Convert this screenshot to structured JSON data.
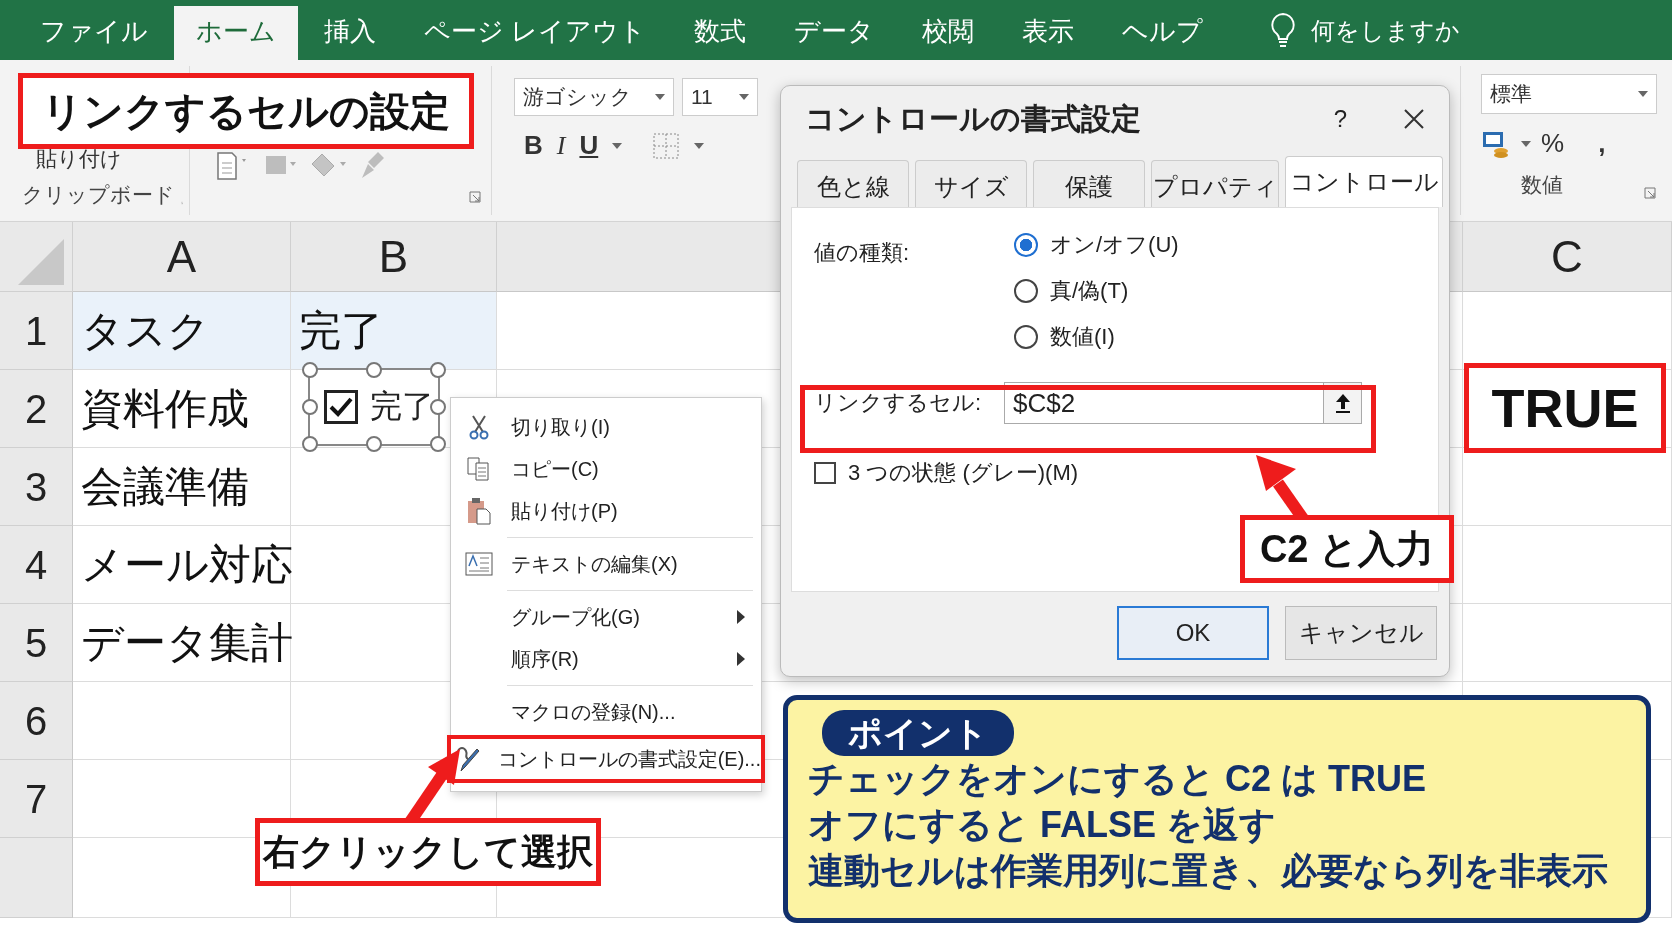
{
  "ribbon_tabs": [
    {
      "label": "ファイル",
      "selected": false
    },
    {
      "label": "ホーム",
      "selected": true
    },
    {
      "label": "挿入",
      "selected": false
    },
    {
      "label": "ページ レイアウト",
      "selected": false
    },
    {
      "label": "数式",
      "selected": false
    },
    {
      "label": "データ",
      "selected": false
    },
    {
      "label": "校閲",
      "selected": false
    },
    {
      "label": "表示",
      "selected": false
    },
    {
      "label": "ヘルプ",
      "selected": false
    }
  ],
  "tell_me": {
    "placeholder": "何をしますか"
  },
  "ribbon": {
    "clipboard": {
      "paste_label": "貼り付け",
      "group_label": "クリップボード"
    },
    "font": {
      "name": "游ゴシック",
      "size": "11",
      "format_buttons": [
        "B",
        "I",
        "U"
      ]
    },
    "number": {
      "format": "標準",
      "percent": "%",
      "comma": ",",
      "group_label": "数値"
    }
  },
  "title_callout": "リンクするセルの設定",
  "sheet": {
    "columns": [
      "A",
      "B",
      "C"
    ],
    "rows": [
      {
        "number": "1",
        "header": true,
        "cells": [
          "タスク",
          "完了"
        ]
      },
      {
        "number": "2",
        "header": false,
        "cells": [
          "資料作成"
        ]
      },
      {
        "number": "3",
        "header": false,
        "cells": [
          "会議準備"
        ]
      },
      {
        "number": "4",
        "header": false,
        "cells": [
          "メール対応"
        ]
      },
      {
        "number": "5",
        "header": false,
        "cells": [
          "データ集計"
        ]
      },
      {
        "number": "6",
        "header": false,
        "cells": []
      },
      {
        "number": "7",
        "header": false,
        "cells": []
      }
    ],
    "checkbox_control": {
      "label": "完了",
      "checked": true
    },
    "result_callout": "TRUE"
  },
  "context_menu": [
    {
      "kind": "item",
      "label": "切り取り(I)",
      "submenu": false,
      "highlighted": false
    },
    {
      "kind": "item",
      "label": "コピー(C)",
      "submenu": false,
      "highlighted": false
    },
    {
      "kind": "item",
      "label": "貼り付け(P)",
      "submenu": false,
      "highlighted": false
    },
    {
      "kind": "separator"
    },
    {
      "kind": "item",
      "label": "テキストの編集(X)",
      "submenu": false,
      "highlighted": false
    },
    {
      "kind": "separator"
    },
    {
      "kind": "item",
      "label": "グループ化(G)",
      "submenu": true,
      "highlighted": false
    },
    {
      "kind": "item",
      "label": "順序(R)",
      "submenu": true,
      "highlighted": false
    },
    {
      "kind": "separator"
    },
    {
      "kind": "item",
      "label": "マクロの登録(N)...",
      "submenu": false,
      "highlighted": false
    },
    {
      "kind": "item",
      "label": "コントロールの書式設定(E)...",
      "submenu": false,
      "highlighted": true
    }
  ],
  "menu_callout": "右クリックして選択",
  "dialog": {
    "title": "コントロールの書式設定",
    "help": "?",
    "tabs": [
      {
        "label": "色と線",
        "selected": false
      },
      {
        "label": "サイズ",
        "selected": false
      },
      {
        "label": "保護",
        "selected": false
      },
      {
        "label": "プロパティ",
        "selected": false
      },
      {
        "label": "コントロール",
        "selected": true
      }
    ],
    "value_type_label": "値の種類:",
    "options": [
      {
        "label": "オン/オフ(U)",
        "selected": true
      },
      {
        "label": "真/偽(T)",
        "selected": false
      },
      {
        "label": "数値(I)",
        "selected": false
      }
    ],
    "link_label": "リンクするセル:",
    "link_value": "$C$2",
    "three_state": {
      "label": "3 つの状態 (グレー)(M)",
      "checked": false
    },
    "buttons": [
      {
        "label": "OK",
        "default": true
      },
      {
        "label": "キャンセル",
        "default": false
      }
    ]
  },
  "input_callout": "C2 と入力",
  "point": {
    "badge": "ポイント",
    "lines": [
      "チェックをオンにすると C2 は TRUE",
      "オフにすると FALSE を返す",
      "連動セルは作業用列に置き、必要なら列を非表示"
    ]
  }
}
